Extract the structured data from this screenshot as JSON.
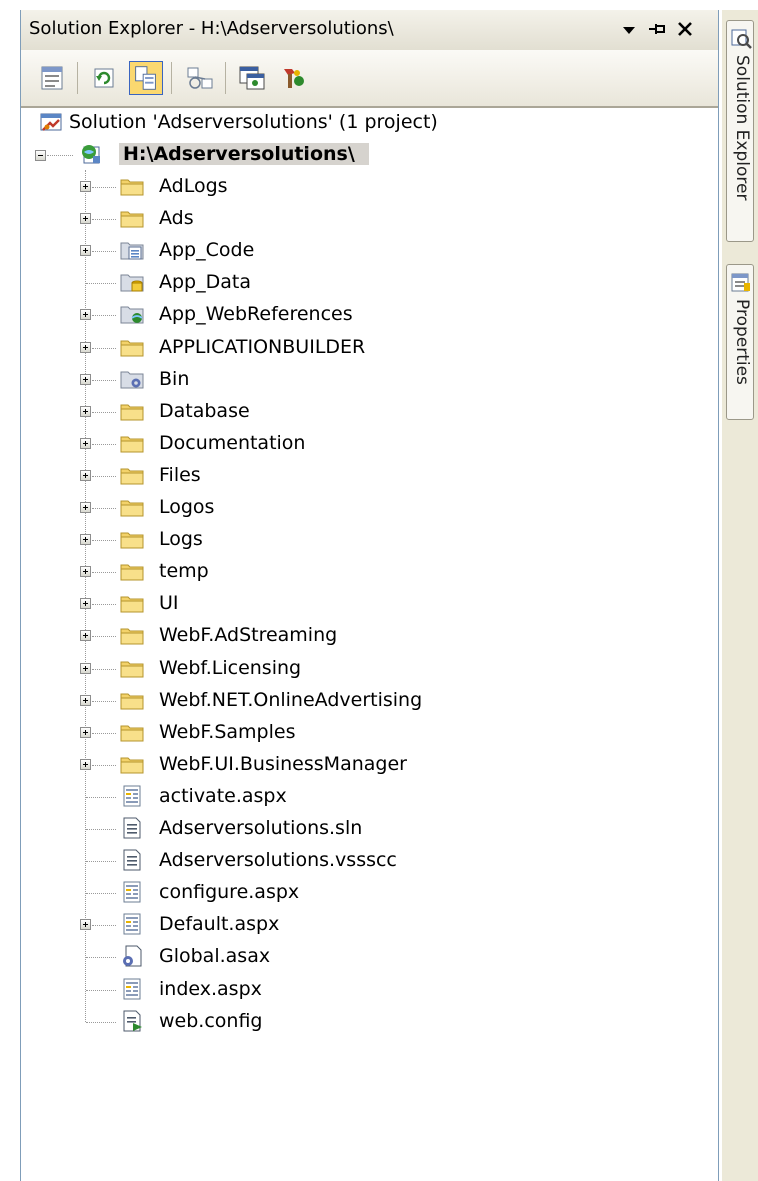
{
  "window": {
    "title": "Solution Explorer - H:\\Adserversolutions\\"
  },
  "toolbar": {
    "buttons": [
      {
        "name": "properties",
        "icon": "properties-icon"
      },
      {
        "name": "refresh",
        "icon": "refresh-icon"
      },
      {
        "name": "nest-related-files",
        "icon": "nest-related-files-icon",
        "active": true
      },
      {
        "name": "view-class-diagram",
        "icon": "class-diagram-icon"
      },
      {
        "name": "copy-web-site",
        "icon": "copy-web-site-icon"
      },
      {
        "name": "asp-net-configuration",
        "icon": "asp-net-configuration-icon"
      }
    ]
  },
  "tree": {
    "solution": "Solution 'Adserversolutions' (1 project)",
    "project": "H:\\Adserversolutions\\",
    "items": [
      {
        "label": "AdLogs",
        "type": "folder",
        "expandable": true
      },
      {
        "label": "Ads",
        "type": "folder",
        "expandable": true
      },
      {
        "label": "App_Code",
        "type": "app-code-folder",
        "expandable": true
      },
      {
        "label": "App_Data",
        "type": "app-data-folder",
        "expandable": false
      },
      {
        "label": "App_WebReferences",
        "type": "web-references-folder",
        "expandable": true
      },
      {
        "label": "APPLICATIONBUILDER",
        "type": "folder",
        "expandable": true
      },
      {
        "label": "Bin",
        "type": "bin-folder",
        "expandable": true
      },
      {
        "label": "Database",
        "type": "folder",
        "expandable": true
      },
      {
        "label": "Documentation",
        "type": "folder",
        "expandable": true
      },
      {
        "label": "Files",
        "type": "folder",
        "expandable": true
      },
      {
        "label": "Logos",
        "type": "folder",
        "expandable": true
      },
      {
        "label": "Logs",
        "type": "folder",
        "expandable": true
      },
      {
        "label": "temp",
        "type": "folder",
        "expandable": true
      },
      {
        "label": "UI",
        "type": "folder",
        "expandable": true
      },
      {
        "label": "WebF.AdStreaming",
        "type": "folder",
        "expandable": true
      },
      {
        "label": "Webf.Licensing",
        "type": "folder",
        "expandable": true
      },
      {
        "label": "Webf.NET.OnlineAdvertising",
        "type": "folder",
        "expandable": true
      },
      {
        "label": "WebF.Samples",
        "type": "folder",
        "expandable": true
      },
      {
        "label": "WebF.UI.BusinessManager",
        "type": "folder",
        "expandable": true
      },
      {
        "label": "activate.aspx",
        "type": "aspx",
        "expandable": false
      },
      {
        "label": "Adserversolutions.sln",
        "type": "text-file",
        "expandable": false
      },
      {
        "label": "Adserversolutions.vssscc",
        "type": "text-file",
        "expandable": false
      },
      {
        "label": "configure.aspx",
        "type": "aspx",
        "expandable": false
      },
      {
        "label": "Default.aspx",
        "type": "aspx",
        "expandable": true
      },
      {
        "label": "Global.asax",
        "type": "asax",
        "expandable": false
      },
      {
        "label": "index.aspx",
        "type": "aspx",
        "expandable": false
      },
      {
        "label": "web.config",
        "type": "config",
        "expandable": false
      }
    ]
  },
  "side_tabs": [
    {
      "label": "Solution Explorer",
      "icon": "solution-explorer-icon"
    },
    {
      "label": "Properties",
      "icon": "properties-icon"
    }
  ],
  "colors": {
    "folder": "#f3d26a",
    "selection": "#d6d3ce",
    "toolbar_active": "#fbd870"
  }
}
